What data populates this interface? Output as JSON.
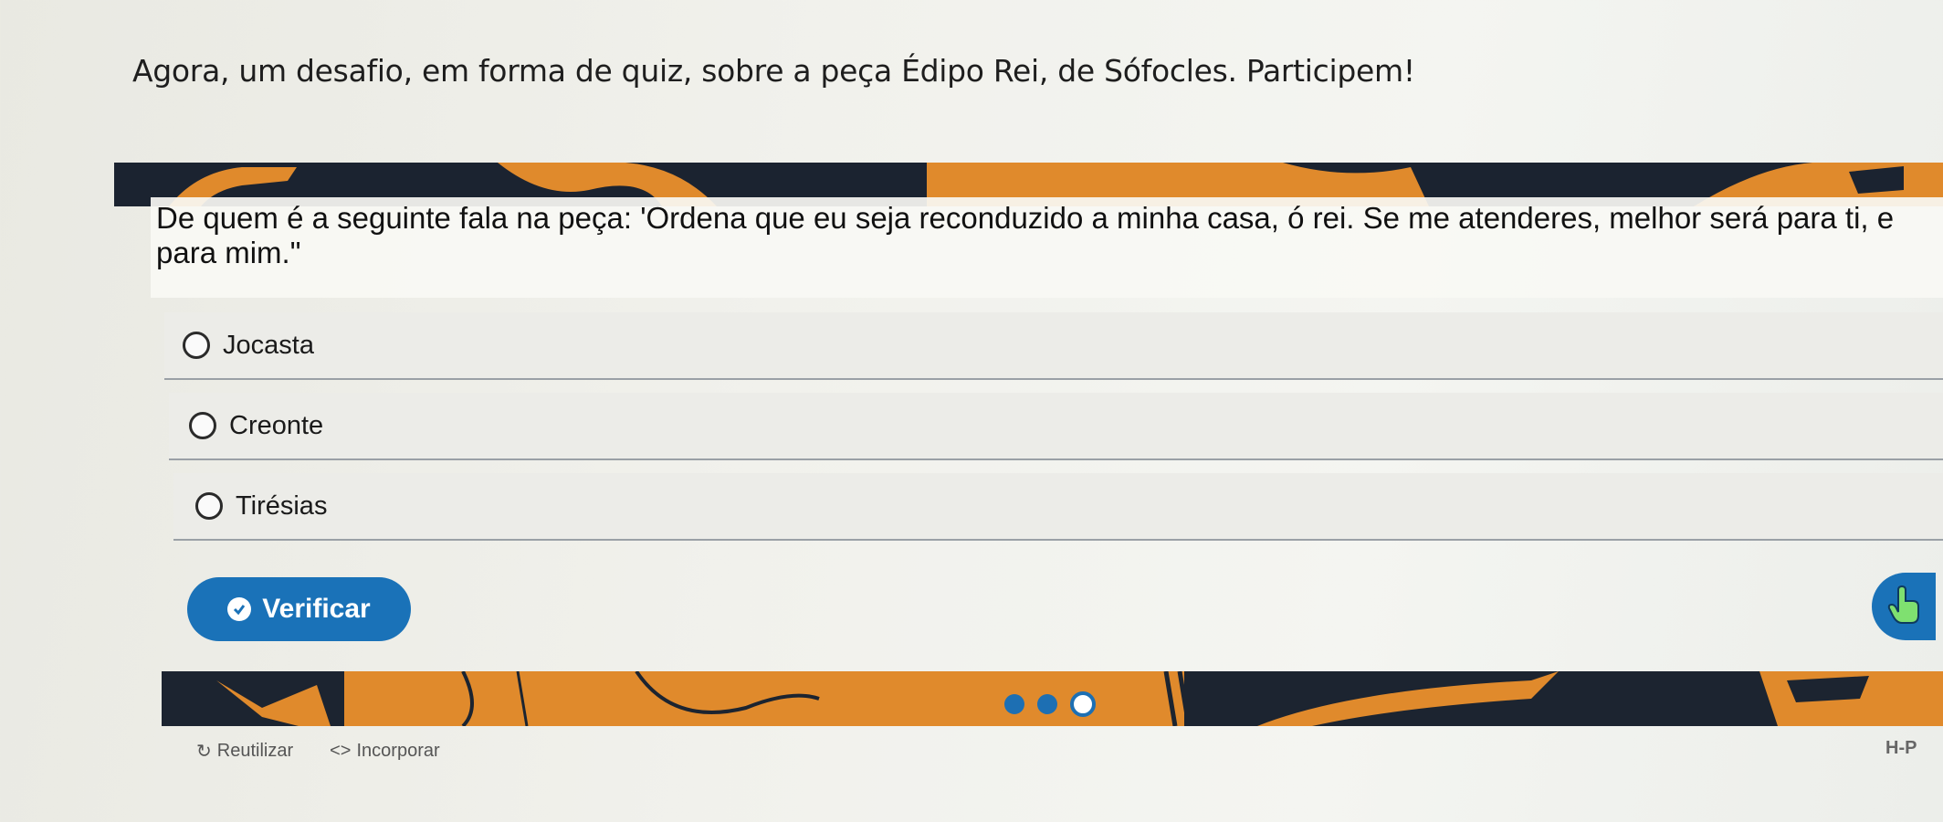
{
  "intro_text": "Agora, um desafio, em forma de quiz, sobre a peça Édipo Rei, de Sófocles. Participem!",
  "quiz": {
    "question": "De quem é a seguinte fala na peça: 'Ordena que eu seja reconduzido a minha casa, ó rei. Se me atenderes, melhor será para ti, e para mim.\"",
    "options": [
      {
        "label": "Jocasta"
      },
      {
        "label": "Creonte"
      },
      {
        "label": "Tirésias"
      }
    ],
    "verify_label": "Verificar",
    "accent_color": "#1a72b8",
    "band_colors": {
      "dark": "#1b2330",
      "orange": "#e08a2c"
    },
    "icons": {
      "check": "check-circle-icon",
      "hand": "hand-pointer-icon",
      "reuse": "refresh-icon",
      "embed": "code-icon"
    }
  },
  "footer": {
    "reuse_label": "Reutilizar",
    "embed_label": "Incorporar",
    "embed_glyph": "<>",
    "reuse_glyph": "↻",
    "brand_mark": "H-P"
  }
}
